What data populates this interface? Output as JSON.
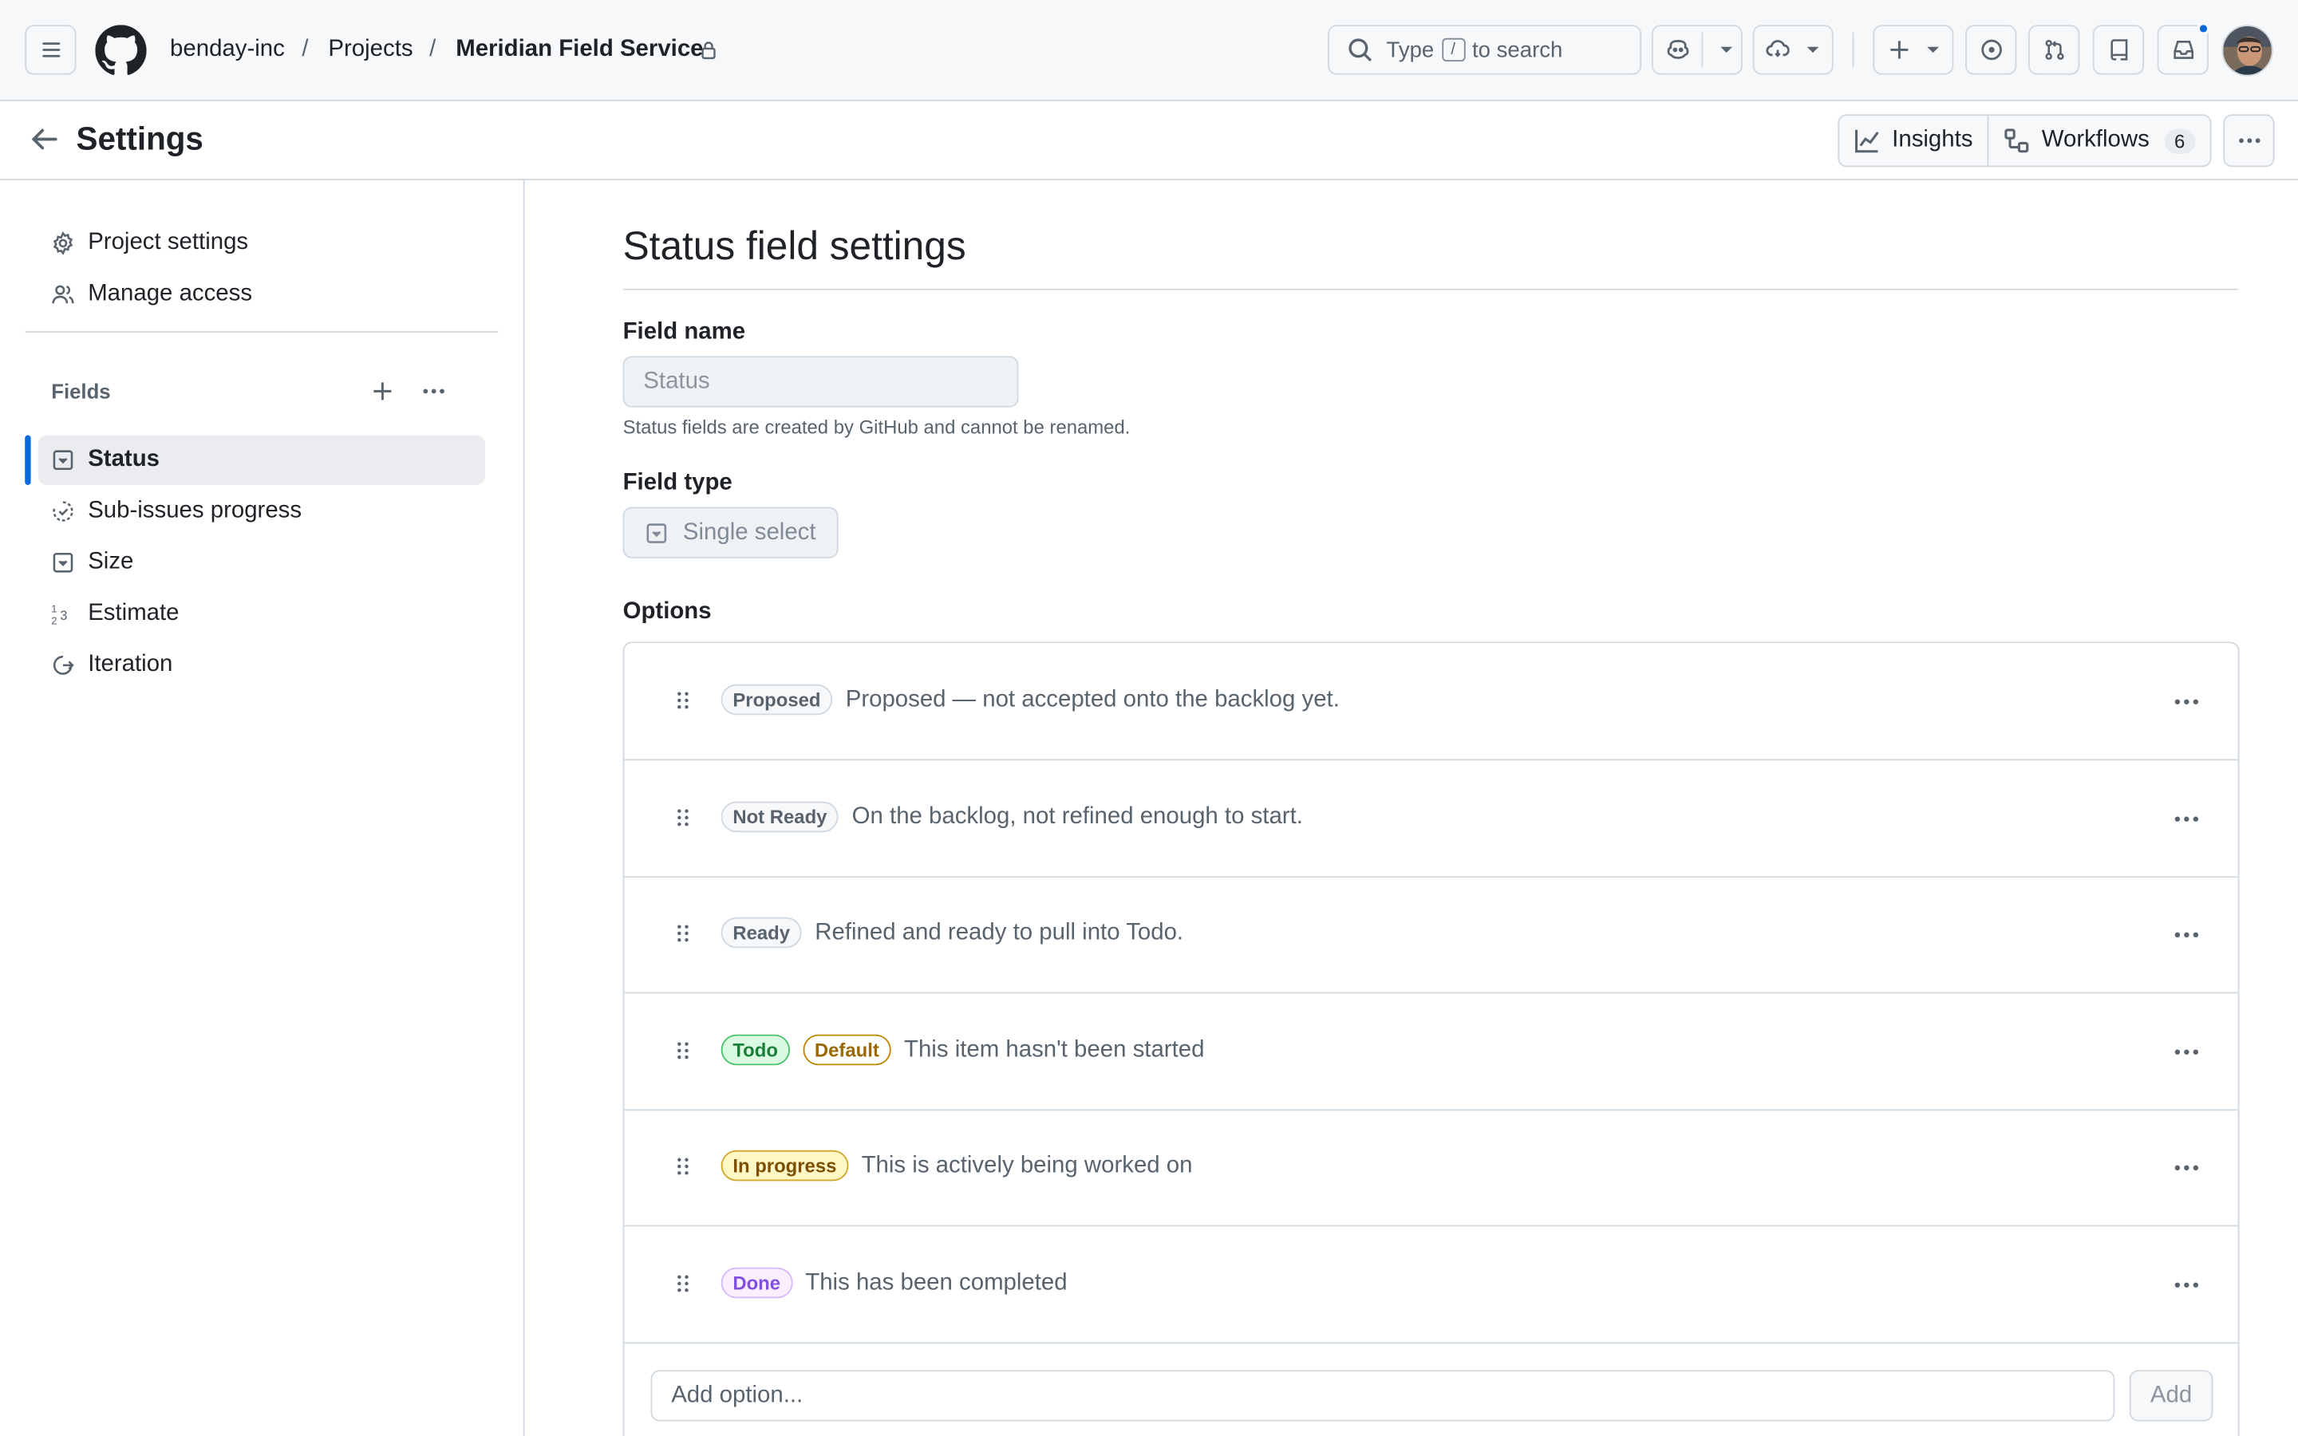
{
  "header": {
    "owner": "benday-inc",
    "projects": "Projects",
    "project_name": "Meridian Field Service",
    "search": {
      "prefix": "Type",
      "key": "/",
      "suffix": "to search"
    }
  },
  "subheader": {
    "title": "Settings",
    "insights_label": "Insights",
    "workflows_label": "Workflows",
    "workflows_count": "6"
  },
  "sidebar": {
    "project_settings": "Project settings",
    "manage_access": "Manage access",
    "fields_label": "Fields",
    "fields": [
      {
        "label": "Status",
        "icon": "single-select-icon"
      },
      {
        "label": "Sub-issues progress",
        "icon": "progress-icon"
      },
      {
        "label": "Size",
        "icon": "single-select-icon"
      },
      {
        "label": "Estimate",
        "icon": "number-icon"
      },
      {
        "label": "Iteration",
        "icon": "iteration-icon"
      }
    ]
  },
  "main": {
    "title": "Status field settings",
    "field_name_label": "Field name",
    "field_name_value": "Status",
    "field_name_hint": "Status fields are created by GitHub and cannot be renamed.",
    "field_type_label": "Field type",
    "field_type_value": "Single select",
    "options_label": "Options",
    "options": [
      {
        "name": "Proposed",
        "description": "Proposed — not accepted onto the backlog yet.",
        "color": "#59636e"
      },
      {
        "name": "Not Ready",
        "description": "On the backlog, not refined enough to start.",
        "color": "#59636e"
      },
      {
        "name": "Ready",
        "description": "Refined and ready to pull into Todo.",
        "color": "#59636e"
      },
      {
        "name": "Todo",
        "badge": "Default",
        "description": "This item hasn't been started",
        "color": "#1a7f37"
      },
      {
        "name": "In progress",
        "description": "This is actively being worked on",
        "color": "#9a6700"
      },
      {
        "name": "Done",
        "description": "This has been completed",
        "color": "#8250df"
      }
    ],
    "add_option_placeholder": "Add option...",
    "add_button": "Add"
  },
  "colors": {
    "accent": "#0969da"
  }
}
